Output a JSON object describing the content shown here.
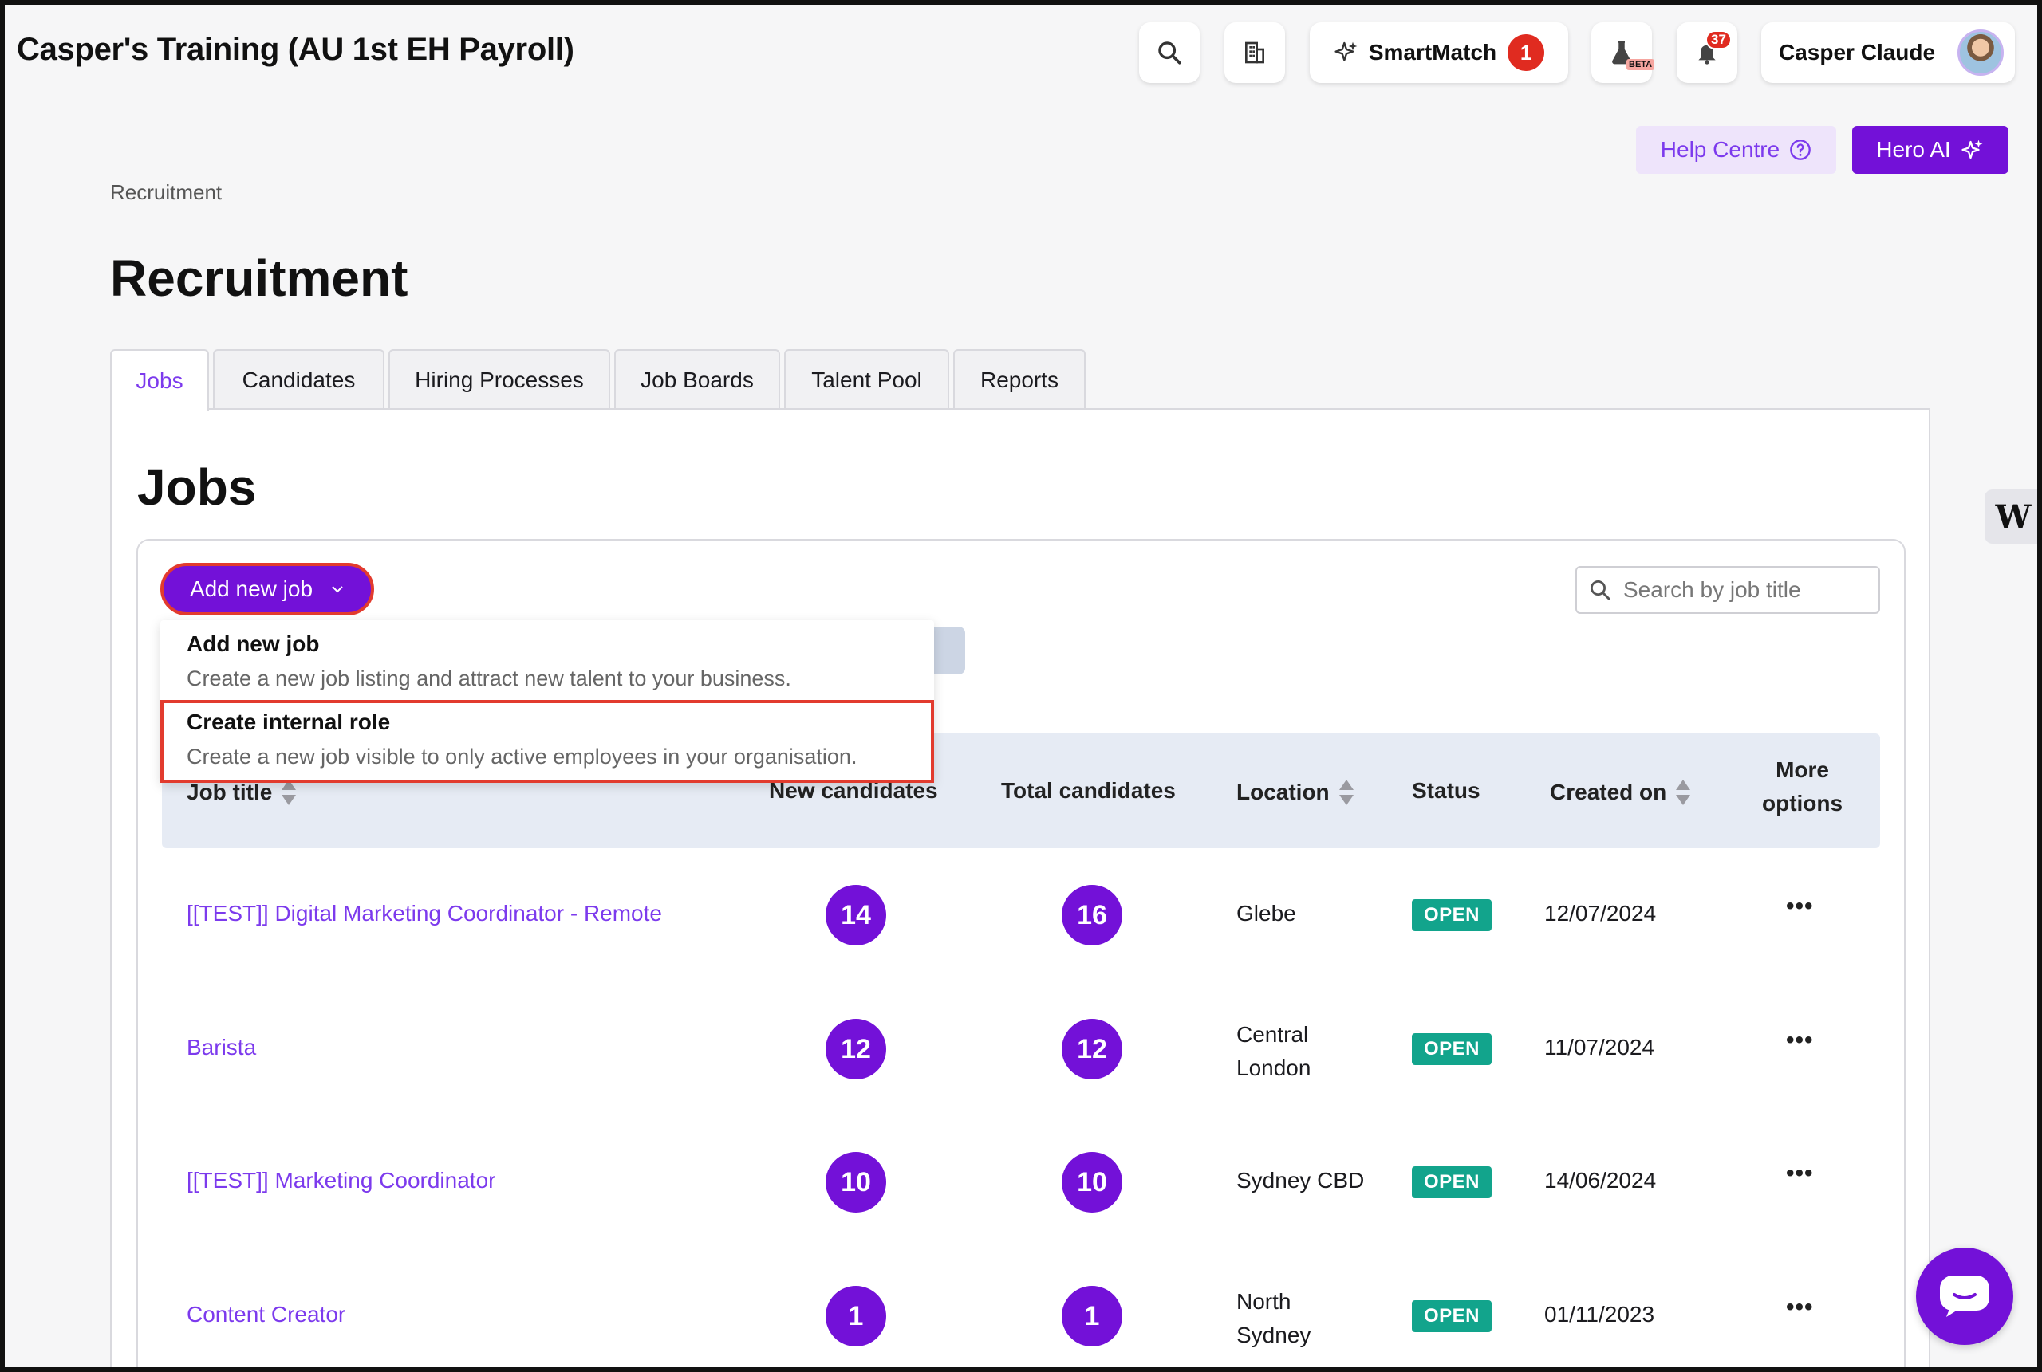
{
  "header": {
    "org_title": "Casper's Training (AU 1st EH Payroll)",
    "smartmatch_label": "SmartMatch",
    "smartmatch_count": "1",
    "beta_tag": "BETA",
    "notifications_count": "37",
    "user_name": "Casper Claude",
    "help_label": "Help Centre",
    "hero_label": "Hero AI"
  },
  "breadcrumb": "Recruitment",
  "page_title": "Recruitment",
  "tabs": [
    {
      "label": "Jobs",
      "active": true
    },
    {
      "label": "Candidates"
    },
    {
      "label": "Hiring Processes"
    },
    {
      "label": "Job Boards"
    },
    {
      "label": "Talent Pool"
    },
    {
      "label": "Reports"
    }
  ],
  "section_title": "Jobs",
  "add_job_label": "Add new job",
  "search": {
    "placeholder": "Search by job title"
  },
  "dropdown": [
    {
      "title": "Add new job",
      "desc": "Create a new job listing and attract new talent to your business."
    },
    {
      "title": "Create internal role",
      "desc": "Create a new job visible to only active employees in your organisation."
    }
  ],
  "table": {
    "headers": {
      "job_title": "Job title",
      "new_candidates": "New candidates",
      "total_candidates": "Total candidates",
      "location": "Location",
      "status": "Status",
      "created_on": "Created on",
      "more_options_1": "More",
      "more_options_2": "options"
    },
    "rows": [
      {
        "title": "[[TEST]] Digital Marketing Coordinator - Remote",
        "new": "14",
        "total": "16",
        "location_1": "Glebe",
        "location_2": "",
        "status": "OPEN",
        "created": "12/07/2024",
        "more": "•••"
      },
      {
        "title": "Barista",
        "new": "12",
        "total": "12",
        "location_1": "Central",
        "location_2": "London",
        "status": "OPEN",
        "created": "11/07/2024",
        "more": "•••"
      },
      {
        "title": "[[TEST]] Marketing Coordinator",
        "new": "10",
        "total": "10",
        "location_1": "Sydney CBD",
        "location_2": "",
        "status": "OPEN",
        "created": "14/06/2024",
        "more": "•••"
      },
      {
        "title": "Content Creator",
        "new": "1",
        "total": "1",
        "location_1": "North",
        "location_2": "Sydney",
        "status": "OPEN",
        "created": "01/11/2023",
        "more": "•••"
      }
    ]
  },
  "side_widget_letter": "W",
  "colors": {
    "brand": "#7311d8",
    "link": "#7c3aed",
    "status_open": "#12a48c",
    "highlight": "#e23b2e"
  }
}
